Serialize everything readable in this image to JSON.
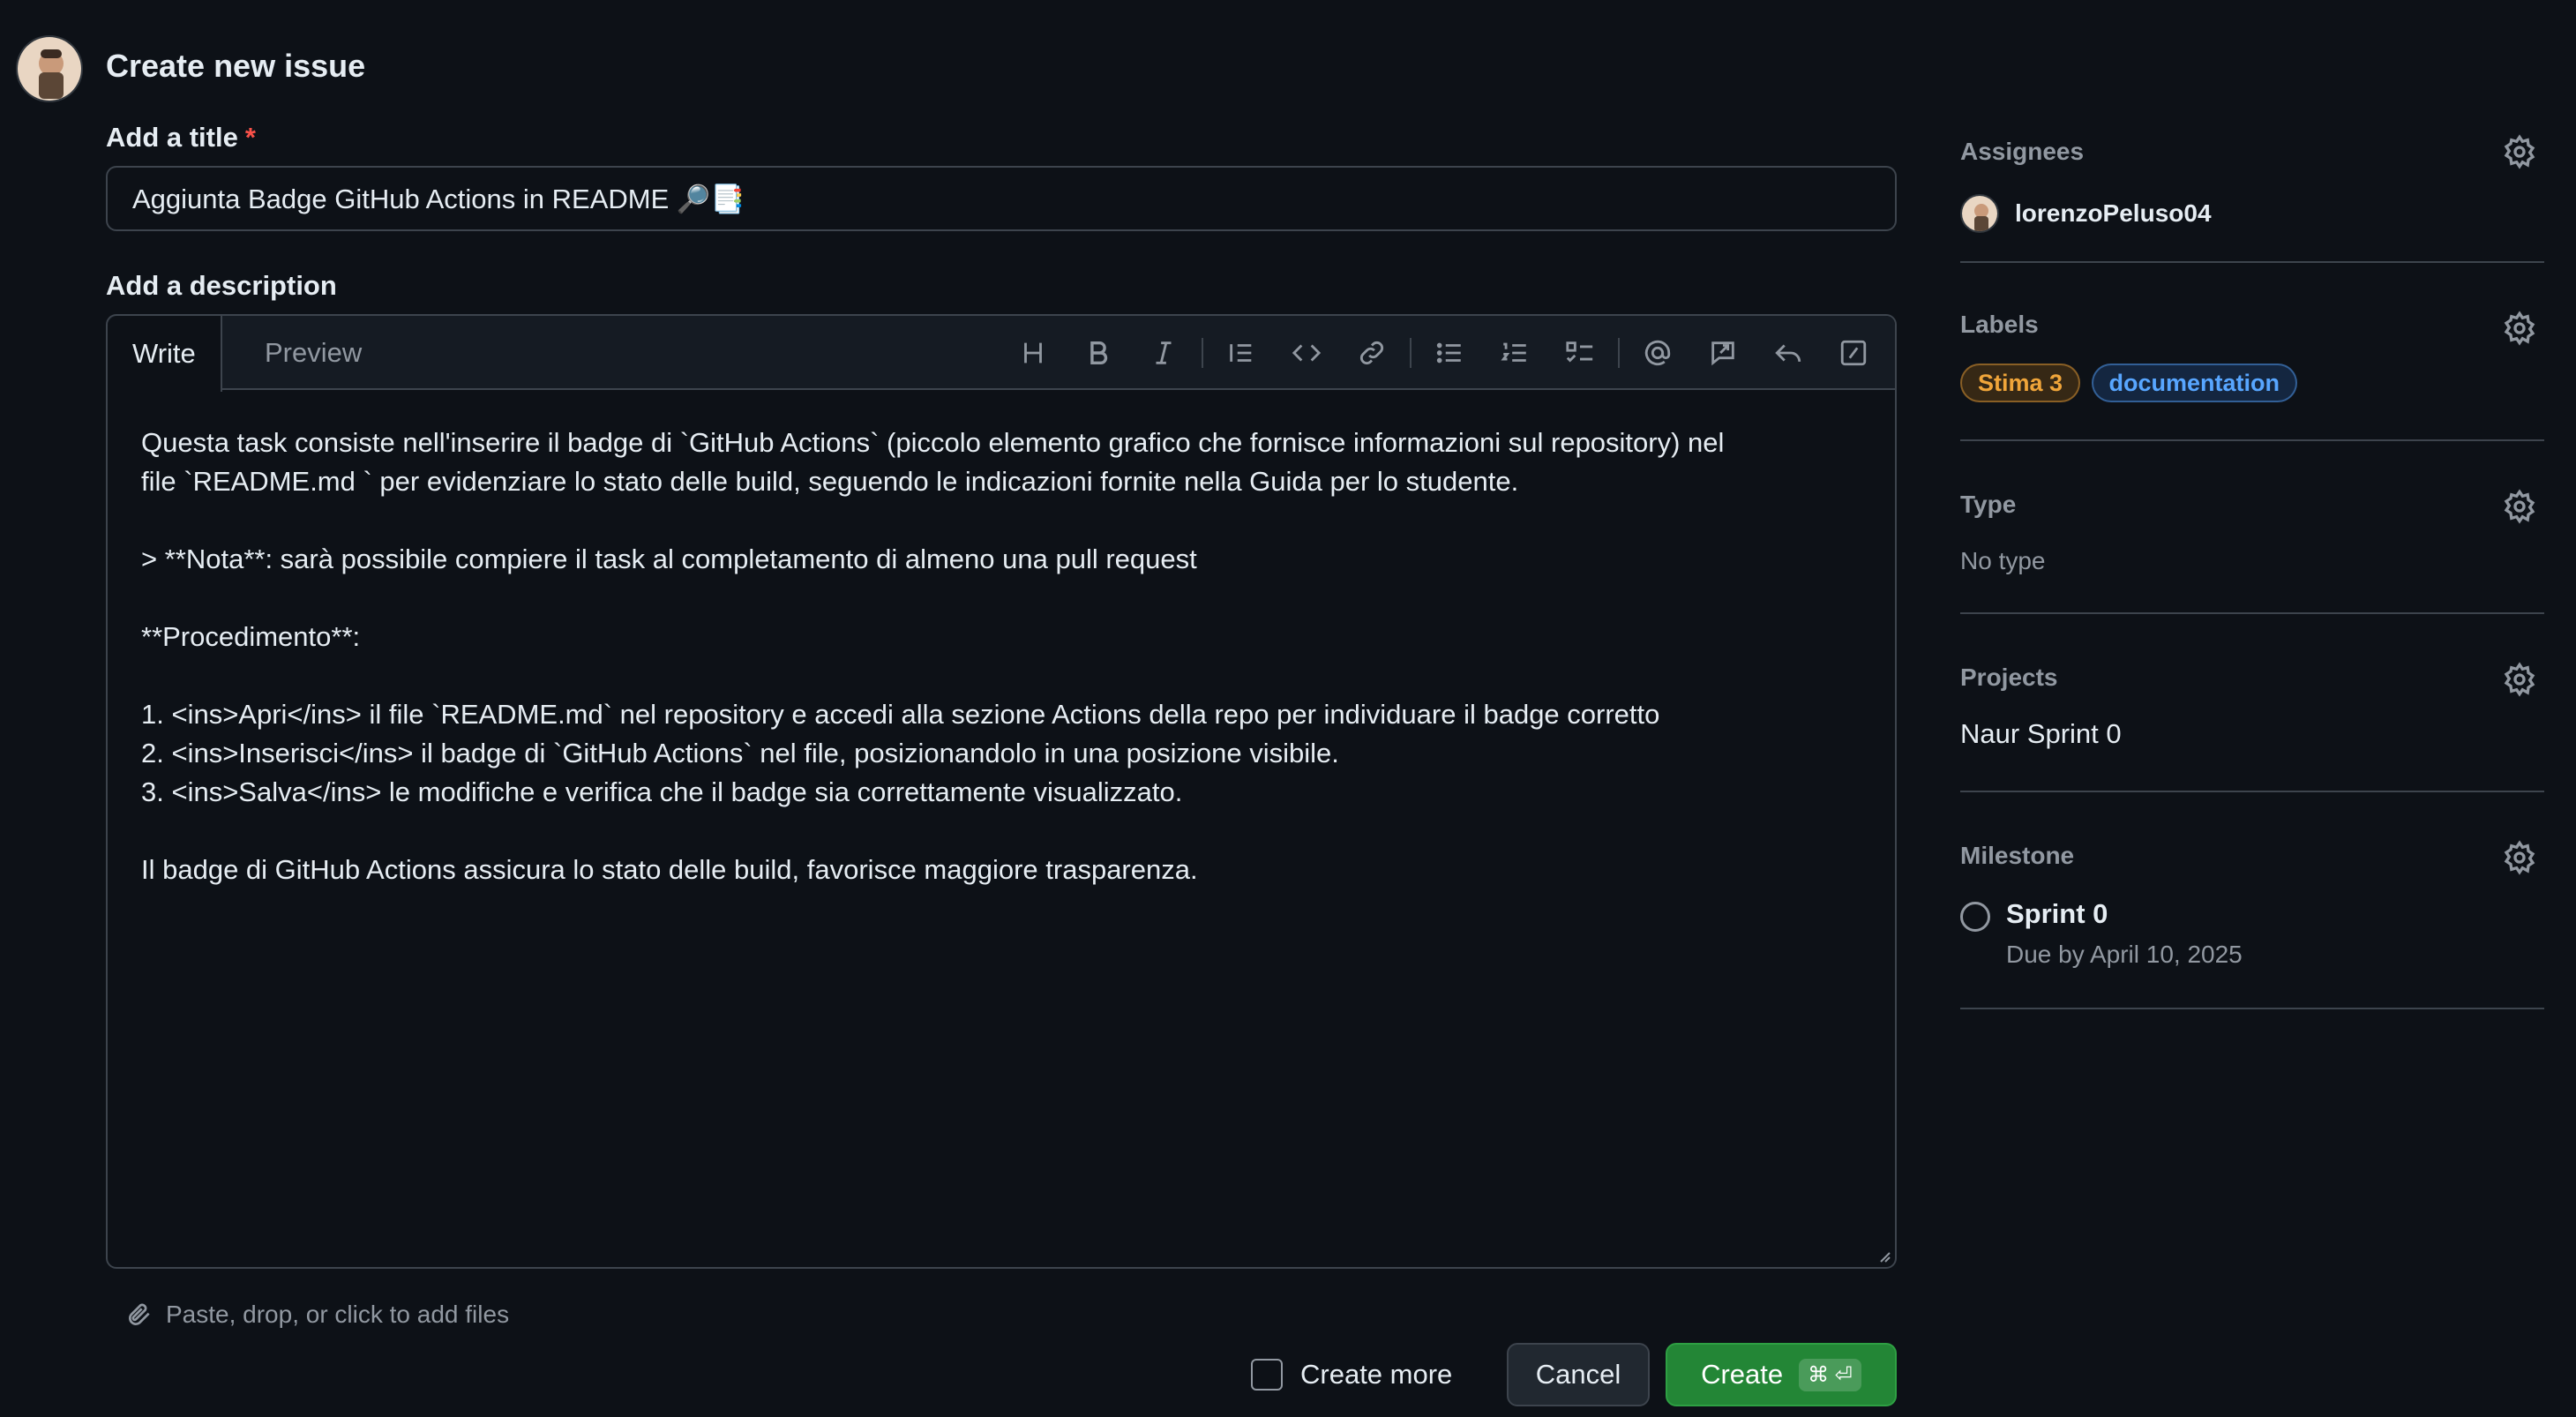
{
  "header": {
    "title": "Create new issue"
  },
  "title_field": {
    "label": "Add a title",
    "required_mark": "*",
    "value": "Aggiunta Badge GitHub Actions in README 🔎📑"
  },
  "description": {
    "label": "Add a description",
    "tabs": {
      "write": "Write",
      "preview": "Preview"
    },
    "body": "Questa task consiste nell'inserire il badge di `GitHub Actions` (piccolo elemento grafico che fornisce informazioni sul repository) nel\nfile `README.md ` per evidenziare lo stato delle build, seguendo le indicazioni fornite nella Guida per lo studente.\n\n> **Nota**: sarà possibile compiere il task al completamento di almeno una pull request\n\n**Procedimento**:\n\n1. <ins>Apri</ins> il file `README.md` nel repository e accedi alla sezione Actions della repo per individuare il badge corretto\n2. <ins>Inserisci</ins> il badge di `GitHub Actions` nel file, posizionandolo in una posizione visibile.\n3. <ins>Salva</ins> le modifiche e verifica che il badge sia correttamente visualizzato.\n\nIl badge di GitHub Actions assicura lo stato delle build, favorisce maggiore trasparenza.",
    "toolbar_icons": [
      "heading-icon",
      "bold-icon",
      "italic-icon",
      "quote-icon",
      "code-icon",
      "link-icon",
      "unordered-list-icon",
      "ordered-list-icon",
      "task-list-icon",
      "mention-icon",
      "reference-icon",
      "saved-reply-icon",
      "slash-command-icon"
    ],
    "attach_hint": "Paste, drop, or click to add files"
  },
  "footer": {
    "create_more": "Create more",
    "cancel": "Cancel",
    "create": "Create",
    "shortcut": "⌘ ⏎"
  },
  "sidebar": {
    "assignees": {
      "title": "Assignees",
      "user": "lorenzoPeluso04"
    },
    "labels": {
      "title": "Labels",
      "items": [
        "Stima 3",
        "documentation"
      ]
    },
    "type": {
      "title": "Type",
      "value": "No type"
    },
    "projects": {
      "title": "Projects",
      "value": "Naur Sprint 0"
    },
    "milestone": {
      "title": "Milestone",
      "name": "Sprint 0",
      "due": "Due by April 10, 2025"
    }
  },
  "colors": {
    "background": "#0d1117",
    "primary_button": "#238636",
    "label_stima": "#f0a53a",
    "label_documentation": "#58a6ff"
  }
}
